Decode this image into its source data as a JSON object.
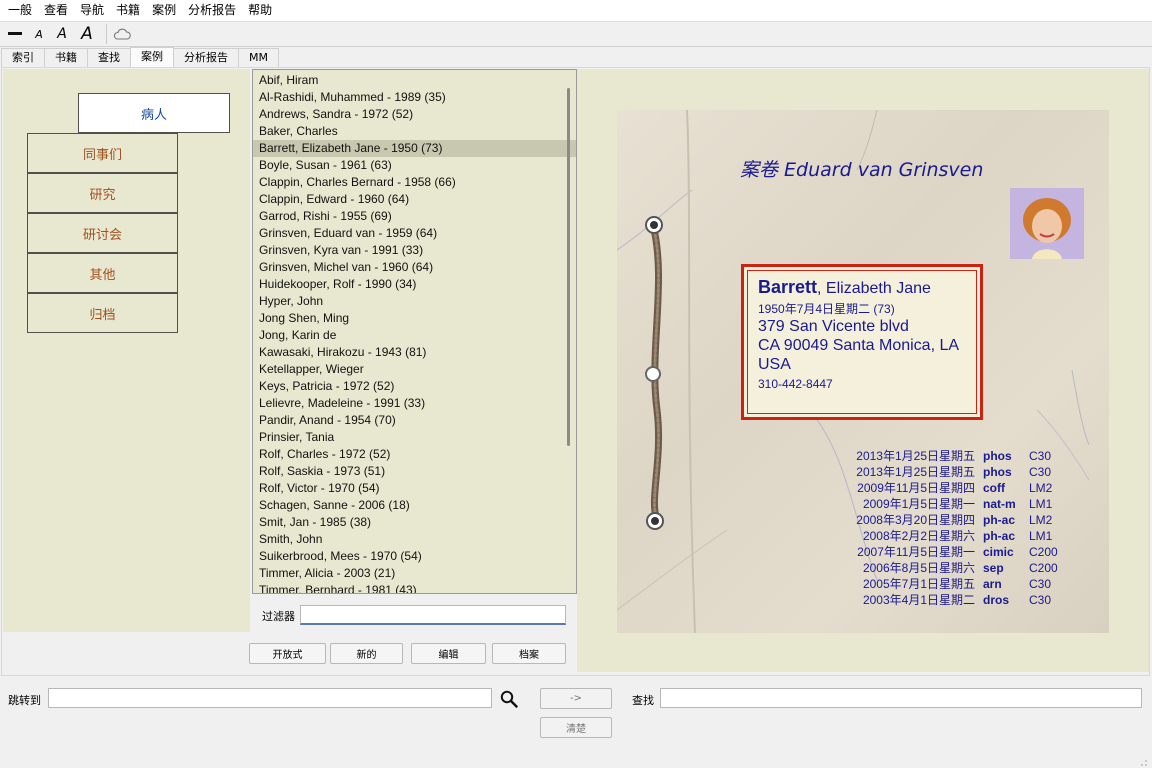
{
  "menu": [
    "一般",
    "查看",
    "导航",
    "书籍",
    "案例",
    "分析报告",
    "帮助"
  ],
  "toolbar": {
    "font_smaller": "A",
    "font_normal": "A",
    "font_larger": "A"
  },
  "tabs": [
    "索引",
    "书籍",
    "查找",
    "案例",
    "分析报告",
    "MM"
  ],
  "active_tab": "案例",
  "leftnav": {
    "selected": "病人",
    "items": [
      "同事们",
      "研究",
      "研讨会",
      "其他",
      "归档"
    ]
  },
  "patients": [
    "Abif, Hiram",
    "Al-Rashidi, Muhammed - 1989 (35)",
    "Andrews, Sandra - 1972 (52)",
    "Baker, Charles",
    "Barrett, Elizabeth Jane - 1950 (73)",
    "Boyle, Susan - 1961 (63)",
    "Clappin, Charles Bernard - 1958 (66)",
    "Clappin, Edward - 1960 (64)",
    "Garrod, Rishi - 1955 (69)",
    "Grinsven, Eduard van - 1959 (64)",
    "Grinsven, Kyra van - 1991 (33)",
    "Grinsven, Michel van - 1960 (64)",
    "Huidekooper, Rolf - 1990 (34)",
    "Hyper, John",
    "Jong Shen, Ming",
    "Jong, Karin de",
    "Kawasaki, Hirakozu - 1943 (81)",
    "Ketellapper, Wieger",
    "Keys, Patricia - 1972 (52)",
    "Lelievre, Madeleine - 1991 (33)",
    "Pandir, Anand - 1954 (70)",
    "Prinsier, Tania",
    "Rolf, Charles - 1972 (52)",
    "Rolf, Saskia - 1973 (51)",
    "Rolf, Victor - 1970 (54)",
    "Schagen, Sanne - 2006 (18)",
    "Smit, Jan - 1985 (38)",
    "Smith, John",
    "Suikerbrood, Mees - 1970 (54)",
    "Timmer, Alicia - 2003 (21)",
    "Timmer, Bernhard - 1981 (43)"
  ],
  "selected_patient": "Barrett, Elizabeth Jane - 1950 (73)",
  "filter": {
    "label": "过滤器",
    "value": ""
  },
  "buttons": {
    "open": "开放式",
    "new": "新的",
    "edit": "编辑",
    "archive": "档案"
  },
  "folder": {
    "title": "案卷 Eduard van Grinsven",
    "card": {
      "last_name": "Barrett",
      "first_names": ", Elizabeth Jane",
      "birth": "1950年7月4日星期二 (73)",
      "street": "379 San Vicente blvd",
      "city": "CA 90049  Santa Monica, LA",
      "country": "USA",
      "phone": "310-442-8447"
    },
    "prescriptions": [
      {
        "date": "2013年1月25日星期五",
        "remedy": "phos",
        "potency": "C30"
      },
      {
        "date": "2013年1月25日星期五",
        "remedy": "phos",
        "potency": "C30"
      },
      {
        "date": "2009年11月5日星期四",
        "remedy": "coff",
        "potency": "LM2"
      },
      {
        "date": "2009年1月5日星期一",
        "remedy": "nat-m",
        "potency": "LM1"
      },
      {
        "date": "2008年3月20日星期四",
        "remedy": "ph-ac",
        "potency": "LM2"
      },
      {
        "date": "2008年2月2日星期六",
        "remedy": "ph-ac",
        "potency": "LM1"
      },
      {
        "date": "2007年11月5日星期一",
        "remedy": "cimic",
        "potency": "C200"
      },
      {
        "date": "2006年8月5日星期六",
        "remedy": "sep",
        "potency": "C200"
      },
      {
        "date": "2005年7月1日星期五",
        "remedy": "arn",
        "potency": "C30"
      },
      {
        "date": "2003年4月1日星期二",
        "remedy": "dros",
        "potency": "C30"
      }
    ]
  },
  "bottom": {
    "goto_label": "跳转到",
    "goto_value": "",
    "arrow_button": "->",
    "find_label": "查找",
    "find_value": "",
    "clear_button": "清楚"
  },
  "colors": {
    "panel_bg": "#e8e8d0",
    "folder_text": "#1a1a90",
    "card_border": "#cc2211",
    "nav_text": "#a05020"
  }
}
